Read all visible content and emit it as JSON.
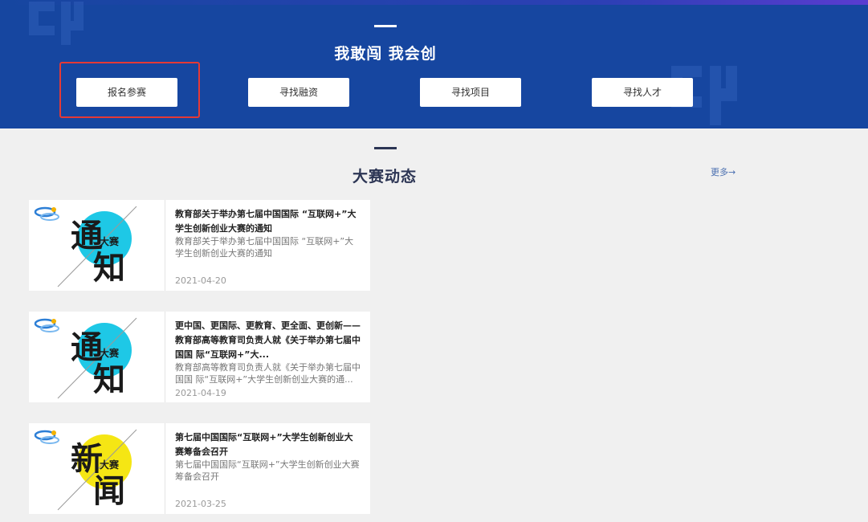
{
  "hero": {
    "slogan": "我敢闯 我会创",
    "buttons": [
      "报名参赛",
      "寻找融资",
      "寻找项目",
      "寻找人才"
    ],
    "bg_color": "#1646a0",
    "highlight_color": "#e53935"
  },
  "news": {
    "title": "大赛动态",
    "more": "更多→",
    "items": [
      {
        "title": "教育部关于举办第七届中国国际 “互联网+”大学生创新创业大赛的通知",
        "summary": "教育部关于举办第七届中国国际 “互联网+”大学生创新创业大赛的通知",
        "date": "2021-04-20",
        "thumb": {
          "big1": "通",
          "big2": "知",
          "small": "大赛",
          "circle_color": "#1ec8e6"
        }
      },
      {
        "title": "更中国、更国际、更教育、更全面、更创新——教育部高等教育司负责人就《关于举办第七届中国国 际“互联网+”大...",
        "summary": "教育部高等教育司负责人就《关于举办第七届中国国 际“互联网+”大学生创新创业大赛的通...",
        "date": "2021-04-19",
        "thumb": {
          "big1": "通",
          "big2": "知",
          "small": "大赛",
          "circle_color": "#1ec8e6"
        }
      },
      {
        "title": "第七届中国国际“互联网+”大学生创新创业大赛筹备会召开",
        "summary": "第七届中国国际“互联网+”大学生创新创业大赛筹备会召开",
        "date": "2021-03-25",
        "thumb": {
          "big1": "新",
          "big2": "闻",
          "small": "大赛",
          "circle_color": "#f5e614"
        }
      }
    ]
  }
}
